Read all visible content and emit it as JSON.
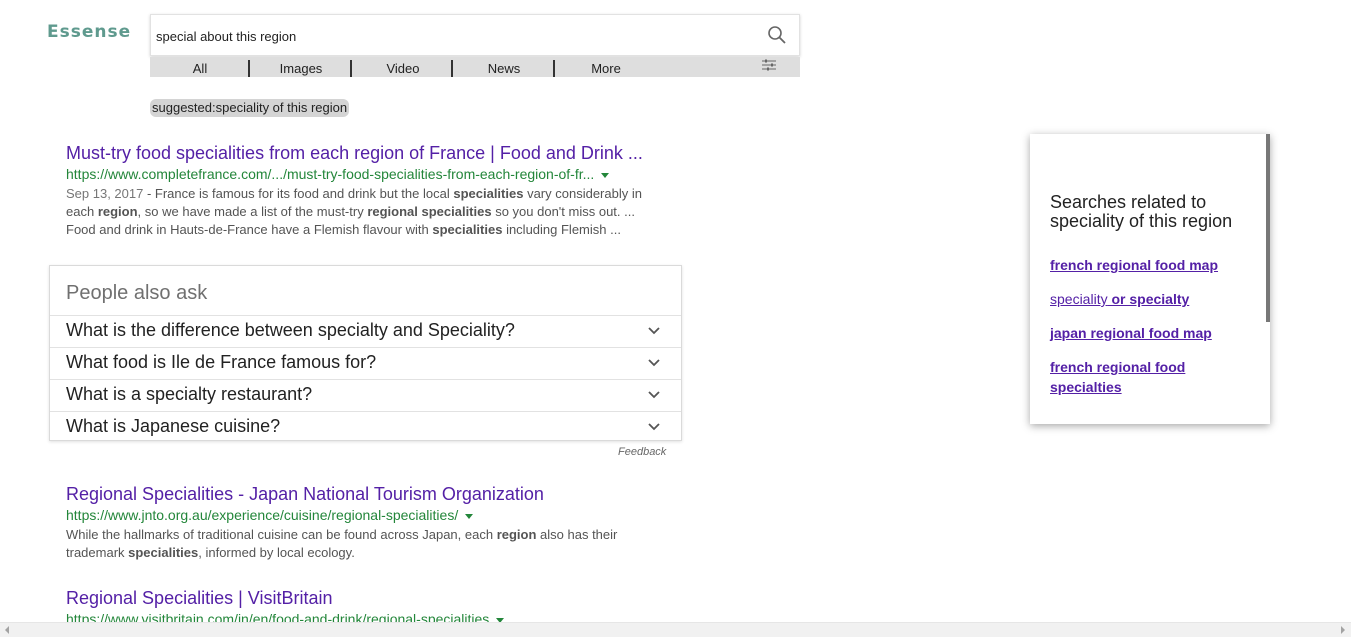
{
  "logo": "Essense",
  "search": {
    "value": "special about this region"
  },
  "tabs": [
    "All",
    "Images",
    "Video",
    "News",
    "More"
  ],
  "suggestion": "suggested:speciality of this region",
  "results": [
    {
      "title": "Must-try food specialities from each region of France | Food and Drink ...",
      "url": "https://www.completefrance.com/.../must-try-food-specialities-from-each-region-of-fr...",
      "date": "Sep 13, 2017",
      "snippet": [
        {
          "t": " - France is famous for its food and drink but the local ",
          "b": false
        },
        {
          "t": "specialities",
          "b": true
        },
        {
          "t": " vary considerably in each ",
          "b": false
        },
        {
          "t": "region",
          "b": true
        },
        {
          "t": ", so we have made a list of the must-try ",
          "b": false
        },
        {
          "t": "regional specialities",
          "b": true
        },
        {
          "t": " so you don't miss out. ... Food and drink in Hauts-de-France have a Flemish flavour with ",
          "b": false
        },
        {
          "t": "specialities",
          "b": true
        },
        {
          "t": " including Flemish ...",
          "b": false
        }
      ]
    },
    {
      "title": "Regional Specialities - Japan National Tourism Organization",
      "url": "https://www.jnto.org.au/experience/cuisine/regional-specialities/",
      "date": "",
      "snippet": [
        {
          "t": "While the hallmarks of traditional cuisine can be found across Japan, each ",
          "b": false
        },
        {
          "t": "region",
          "b": true
        },
        {
          "t": " also has their trademark ",
          "b": false
        },
        {
          "t": "specialities",
          "b": true
        },
        {
          "t": ", informed by local ecology.",
          "b": false
        }
      ]
    },
    {
      "title": "Regional Specialities | VisitBritain",
      "url": "https://www.visitbritain.com/in/en/food-and-drink/regional-specialities",
      "date": "",
      "snippet": []
    }
  ],
  "people_also_ask": {
    "title": "People also ask",
    "questions": [
      "What is the difference between specialty and Speciality?",
      "What food is Ile de France famous for?",
      "What is a specialty restaurant?",
      "What is Japanese cuisine?"
    ],
    "feedback": "Feedback"
  },
  "related": {
    "title": "Searches related to speciality of this region",
    "links": [
      [
        {
          "t": "french regional food map",
          "b": true
        }
      ],
      [
        {
          "t": "speciality",
          "b": false
        },
        {
          "t": " or specialty",
          "b": true
        }
      ],
      [
        {
          "t": "japan regional food map",
          "b": true
        }
      ],
      [
        {
          "t": "french regional food specialties",
          "b": true
        }
      ]
    ]
  },
  "colors": {
    "link": "#5420a6",
    "url": "#23863a",
    "logo": "#5f9a8e"
  }
}
